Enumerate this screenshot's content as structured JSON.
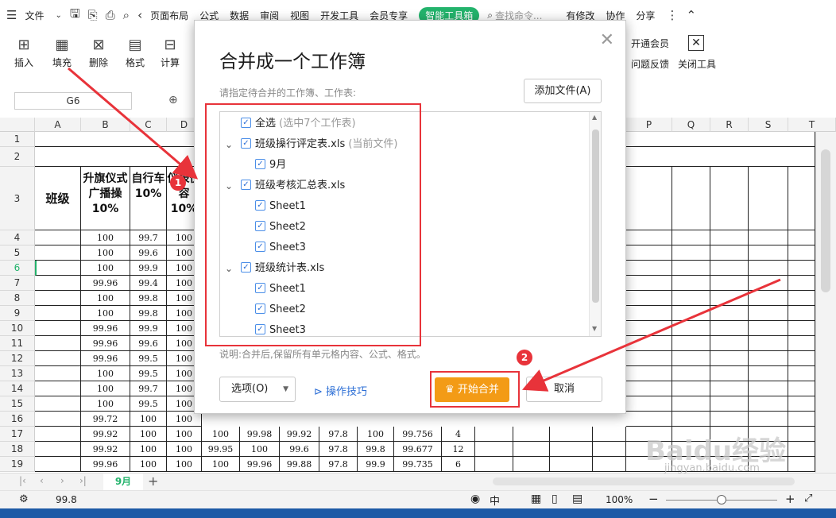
{
  "menubar": {
    "file_label": "文件",
    "items": [
      "页面布局",
      "公式",
      "数据",
      "审阅",
      "视图",
      "开发工具",
      "会员专享"
    ],
    "smart_toolbox": "智能工具箱",
    "search_placeholder": "查找命令...",
    "modified": "有修改",
    "collab": "协作",
    "share": "分享"
  },
  "ribbon": {
    "insert": "插入",
    "fill": "填充",
    "delete": "删除",
    "format": "格式",
    "calc": "计算",
    "open_member": "开通会员",
    "feedback": "问题反馈",
    "close_tools": "关闭工具"
  },
  "formula": {
    "cell_ref": "G6"
  },
  "sheet": {
    "columns": [
      "A",
      "B",
      "C",
      "D",
      "P",
      "Q",
      "R",
      "S",
      "T"
    ],
    "rows": [
      "1",
      "2",
      "3",
      "4",
      "5",
      "6",
      "7",
      "8",
      "9",
      "10",
      "11",
      "12",
      "13",
      "14",
      "15",
      "16",
      "17",
      "18",
      "19"
    ],
    "header_banji": "班级",
    "header_b": "升旗仪式广播操10%",
    "header_c": "自行车10%",
    "header_d": "仪表仪容10%",
    "col_b": [
      "100",
      "100",
      "100",
      "99.96",
      "100",
      "100",
      "99.96",
      "99.96",
      "99.96",
      "100",
      "100",
      "100",
      "99.72",
      "99.92",
      "99.92",
      "99.96"
    ],
    "col_c": [
      "99.7",
      "99.6",
      "99.9",
      "99.4",
      "99.8",
      "99.8",
      "99.9",
      "99.6",
      "99.5",
      "99.5",
      "99.7",
      "99.5",
      "100",
      "100",
      "100",
      "100"
    ],
    "col_d": [
      "100",
      "100",
      "100",
      "100",
      "100",
      "100",
      "100",
      "100",
      "100",
      "100",
      "100",
      "100",
      "100",
      "100",
      "100",
      "100"
    ],
    "row17_extra": [
      "100",
      "99.98",
      "99.92",
      "97.8",
      "100",
      "99.756",
      "4"
    ],
    "row18_extra": [
      "99.95",
      "100",
      "99.6",
      "97.8",
      "99.8",
      "99.677",
      "12"
    ],
    "row19_extra": [
      "100",
      "99.96",
      "99.88",
      "97.8",
      "99.9",
      "99.735",
      "6"
    ]
  },
  "tabs": {
    "active": "9月"
  },
  "status": {
    "value": "99.8",
    "zoom": "100%"
  },
  "dialog": {
    "title": "合并成一个工作簿",
    "prompt": "请指定待合并的工作簿、工作表:",
    "add_file": "添加文件(A)",
    "select_all": "全选",
    "select_all_hint": "(选中7个工作表)",
    "book1": "班级操行评定表.xls",
    "book1_hint": "(当前文件)",
    "book1_sheet": "9月",
    "book2": "班级考核汇总表.xls",
    "book2_sheets": [
      "Sheet1",
      "Sheet2",
      "Sheet3"
    ],
    "book3": "班级统计表.xls",
    "book3_sheets": [
      "Sheet1",
      "Sheet2",
      "Sheet3"
    ],
    "description": "说明:合并后,保留所有单元格内容、公式、格式。",
    "options": "选项(O)",
    "tips": "操作技巧",
    "start": "开始合并",
    "cancel": "取消"
  },
  "annotations": {
    "badge1": "1",
    "badge2": "2"
  },
  "watermark": {
    "brand": "Baidu经验",
    "url": "jingyan.baidu.com"
  },
  "colors": {
    "accent": "#23b36c",
    "start_button": "#f39b16",
    "annotation_red": "#e8333a",
    "link_blue": "#2d6fd6"
  }
}
